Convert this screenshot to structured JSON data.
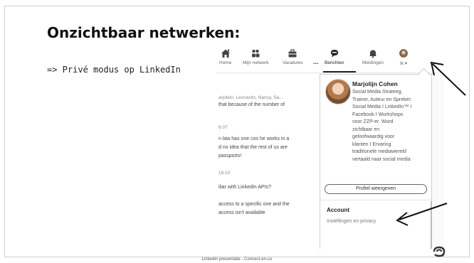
{
  "slide": {
    "title": "Onzichtbaar netwerken:",
    "bullet": "=> Privé modus op LinkedIn",
    "footer": "LinkedIn presentatie - Connect-en-co"
  },
  "navbar": {
    "items": [
      {
        "label": "Home",
        "icon": "home-icon"
      },
      {
        "label": "Mijn netwerk",
        "icon": "network-icon"
      },
      {
        "label": "Vacatures",
        "icon": "briefcase-icon"
      },
      {
        "label": "Berichten",
        "icon": "messaging-icon"
      },
      {
        "label": "Meldingen",
        "icon": "bell-icon"
      },
      {
        "label": "Ik ▾",
        "icon": "profile-avatar-icon"
      }
    ],
    "active": "Berichten"
  },
  "messages": {
    "participants": "arjolein, Leonardo, Nancy, Sa...",
    "dots": "...",
    "lines": [
      "that because of the number of",
      "6:07",
      "n law has one cos he works in a",
      "d no idea that the rest of us are",
      "passports!",
      "16:10",
      "iliar with LinkedIn APIs?",
      "access to a specific one and the",
      "access isn't available"
    ]
  },
  "profile_menu": {
    "name": "Marjolijn Cohen",
    "headline_lines": [
      "Social Media Strateeg,",
      "Trainer, Auteur en Spreker:",
      "Social Media I LinkedIn™ I",
      "Facebook I Workshops",
      "voor ZZP-er. Word",
      "zichtbaar en",
      "geloofwaardig voor",
      "klanten I Ervaring",
      "traditionele mediawereld",
      "vertaald naar social media"
    ],
    "view_profile_label": "Profiel weergeven",
    "account_title": "Account",
    "settings_link": "Instellingen en privacy"
  },
  "colors": {
    "slide_bg": "#ffffff",
    "nav_active_underline": "#222222",
    "annotation_arrow": "#111111"
  }
}
